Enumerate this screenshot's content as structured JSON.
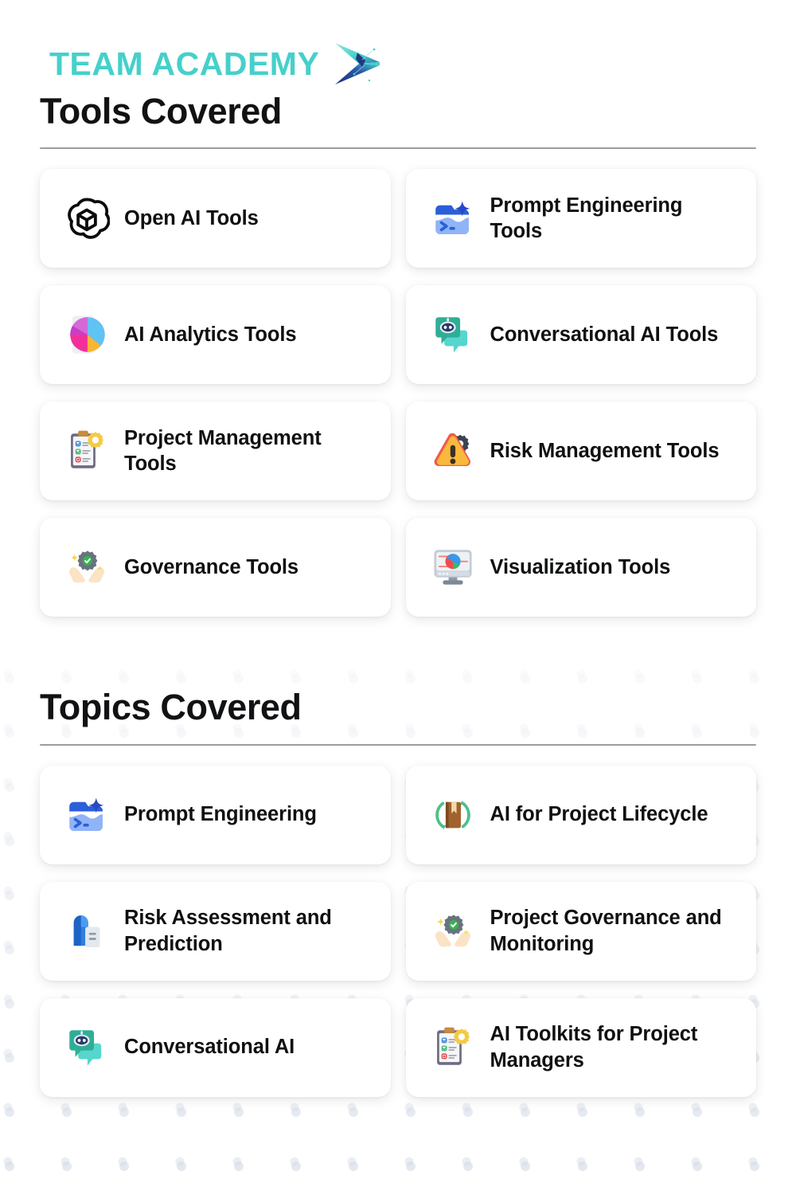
{
  "brand": {
    "name": "TEAM ACADEMY",
    "logo_icon": "arrow-chevron-logo",
    "accent_color": "#45D0CB",
    "logo_arrow_dark_color": "#22307F"
  },
  "colors": {
    "heading": "#111214",
    "divider": "#9B9DA1",
    "card_background": "#FFFFFF",
    "page_background": "#FFFFFF",
    "dot_pattern": "#CDD5E2"
  },
  "sections": [
    {
      "id": "tools-covered",
      "title": "Tools Covered",
      "cards": [
        {
          "label": "Open AI Tools",
          "icon": "openai-logo-icon"
        },
        {
          "label": "Prompt Engineering Tools",
          "icon": "prompt-terminal-sparkle-icon"
        },
        {
          "label": "AI Analytics Tools",
          "icon": "pie-chart-analytics-icon"
        },
        {
          "label": "Conversational AI Tools",
          "icon": "chatbot-speech-bubble-icon"
        },
        {
          "label": "Project Management Tools",
          "icon": "clipboard-checklist-gear-icon"
        },
        {
          "label": "Risk Management Tools",
          "icon": "warning-triangle-gear-icon"
        },
        {
          "label": "Governance Tools",
          "icon": "hands-gear-check-icon"
        },
        {
          "label": "Visualization Tools",
          "icon": "monitor-pie-chart-icon"
        }
      ]
    },
    {
      "id": "topics-covered",
      "title": "Topics Covered",
      "cards": [
        {
          "label": "Prompt Engineering",
          "icon": "prompt-terminal-sparkle-icon"
        },
        {
          "label": "AI for Project Lifecycle",
          "icon": "book-recycle-arrows-icon"
        },
        {
          "label": "Risk Assessment and Prediction",
          "icon": "blue-document-report-icon"
        },
        {
          "label": "Project Governance and Monitoring",
          "icon": "hands-gear-check-icon"
        },
        {
          "label": "Conversational AI",
          "icon": "chatbot-speech-bubble-icon"
        },
        {
          "label": "AI Toolkits for Project Managers",
          "icon": "clipboard-checklist-gear-icon"
        }
      ]
    }
  ]
}
